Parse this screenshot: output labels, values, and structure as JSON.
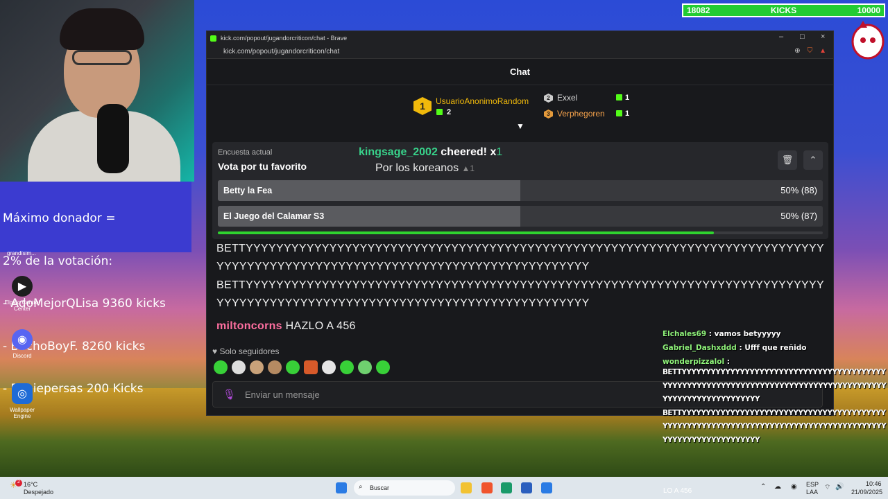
{
  "kicks_goal": {
    "current": "18082",
    "label": "KICKS",
    "target": "10000"
  },
  "donor_panel": {
    "lines": [
      "Máximo donador =",
      "2% de la votación:",
      "- AdoMejorQLisa 9360 kicks",
      "- BochoBoyF. 8260 kicks",
      "- Robiepersas 200 Kicks"
    ],
    "under_label": "grandísim..."
  },
  "desktop_icons": [
    {
      "label": "Elgato Control Center",
      "icon": "elgato-icon"
    },
    {
      "label": "Discord",
      "icon": "discord-icon"
    },
    {
      "label": "Wallpaper Engine",
      "icon": "wallpaper-engine-icon"
    }
  ],
  "browser": {
    "title": "kick.com/popout/jugandorcriticon/chat - Brave",
    "url": "kick.com/popout/jugandorcriticon/chat",
    "controls": {
      "minimize": "–",
      "maximize": "□",
      "close": "×"
    }
  },
  "chat": {
    "header": "Chat",
    "leaderboard": {
      "first": {
        "rank": "1",
        "name": "UsuarioAnonimoRandom",
        "count": "2"
      },
      "second": {
        "rank": "2",
        "name": "Exxel",
        "count": "1"
      },
      "third": {
        "rank": "3",
        "name": "Verphegoren",
        "count": "1"
      }
    },
    "poll": {
      "caption": "Encuesta actual",
      "question": "Vota por tu favorito",
      "options": [
        {
          "label": "Betty la Fea",
          "result": "50% (88)",
          "fraction": 0.5
        },
        {
          "label": "El Juego del Calamar S3",
          "result": "50% (87)",
          "fraction": 0.5
        }
      ],
      "time_remaining_fraction": 0.82
    },
    "cheer": {
      "user": "kingsage_2002",
      "text": " cheered! x",
      "amount": "1",
      "message": "Por los koreanos",
      "gem_count": "1"
    },
    "messages": [
      {
        "text": "BETTYYYYYYYYYYYYYYYYYYYYYYYYYYYYYYYYYYYYYYYYYYYYYYYYYYYYYYYYYYYYYYYYYYYYYYYYYYYYYYYYYYYYYYYYYYYYYYYYYYYYYYYYYYYYYYYYYYYYYYYYYYYYY"
      },
      {
        "text": "BETTYYYYYYYYYYYYYYYYYYYYYYYYYYYYYYYYYYYYYYYYYYYYYYYYYYYYYYYYYYYYYYYYYYYYYYYYYYYYYYYYYYYYYYYYYYYYYYYYYYYYYYYYYYYYYYYYYYYYYYYYYYYYY"
      },
      {
        "user": "miltoncorns",
        "text": " HAZLO A 456"
      }
    ],
    "followers_only": "Solo seguidores",
    "input_placeholder": "Enviar un mensaje"
  },
  "overlay_chat": [
    {
      "user": "Elchales69",
      "text": " : vamos betyyyyy"
    },
    {
      "user": "Gabriel_Dashxddd",
      "text": " : Ufff que reñido"
    },
    {
      "user": "wonderpizzalol",
      "text": " :"
    }
  ],
  "overlay_long_messages": [
    "BETTYYYYYYYYYYYYYYYYYYYYYYYYYYYYYYYYYYYYYYYYYYYYYYYYYYYYYYYYYYYYYYYYYYYYYYYYYYYYYYYYYYYYYYYYYYYYYYYYYYYYYYYYYYYY",
    "BETTYYYYYYYYYYYYYYYYYYYYYYYYYYYYYYYYYYYYYYYYYYYYYYYYYYYYYYYYYYYYYYYYYYYYYYYYYYYYYYYYYYYYYYYYYYYYYYYYYYYYYYYYYYYY"
  ],
  "taskbar": {
    "weather_temp": "16°C",
    "weather_desc": "Despejado",
    "weather_badge": "2",
    "search_placeholder": "Buscar",
    "ticker": "LO A 456",
    "lang_top": "ESP",
    "lang_bottom": "LAA",
    "time": "10:46",
    "date": "21/09/2025"
  },
  "colors": {
    "kick_green": "#53fc18",
    "poll_timer": "#2fd32f",
    "cheer_user": "#38d38b",
    "mention_user": "#ff6fa0",
    "donor_bg": "#3b3bd0"
  }
}
